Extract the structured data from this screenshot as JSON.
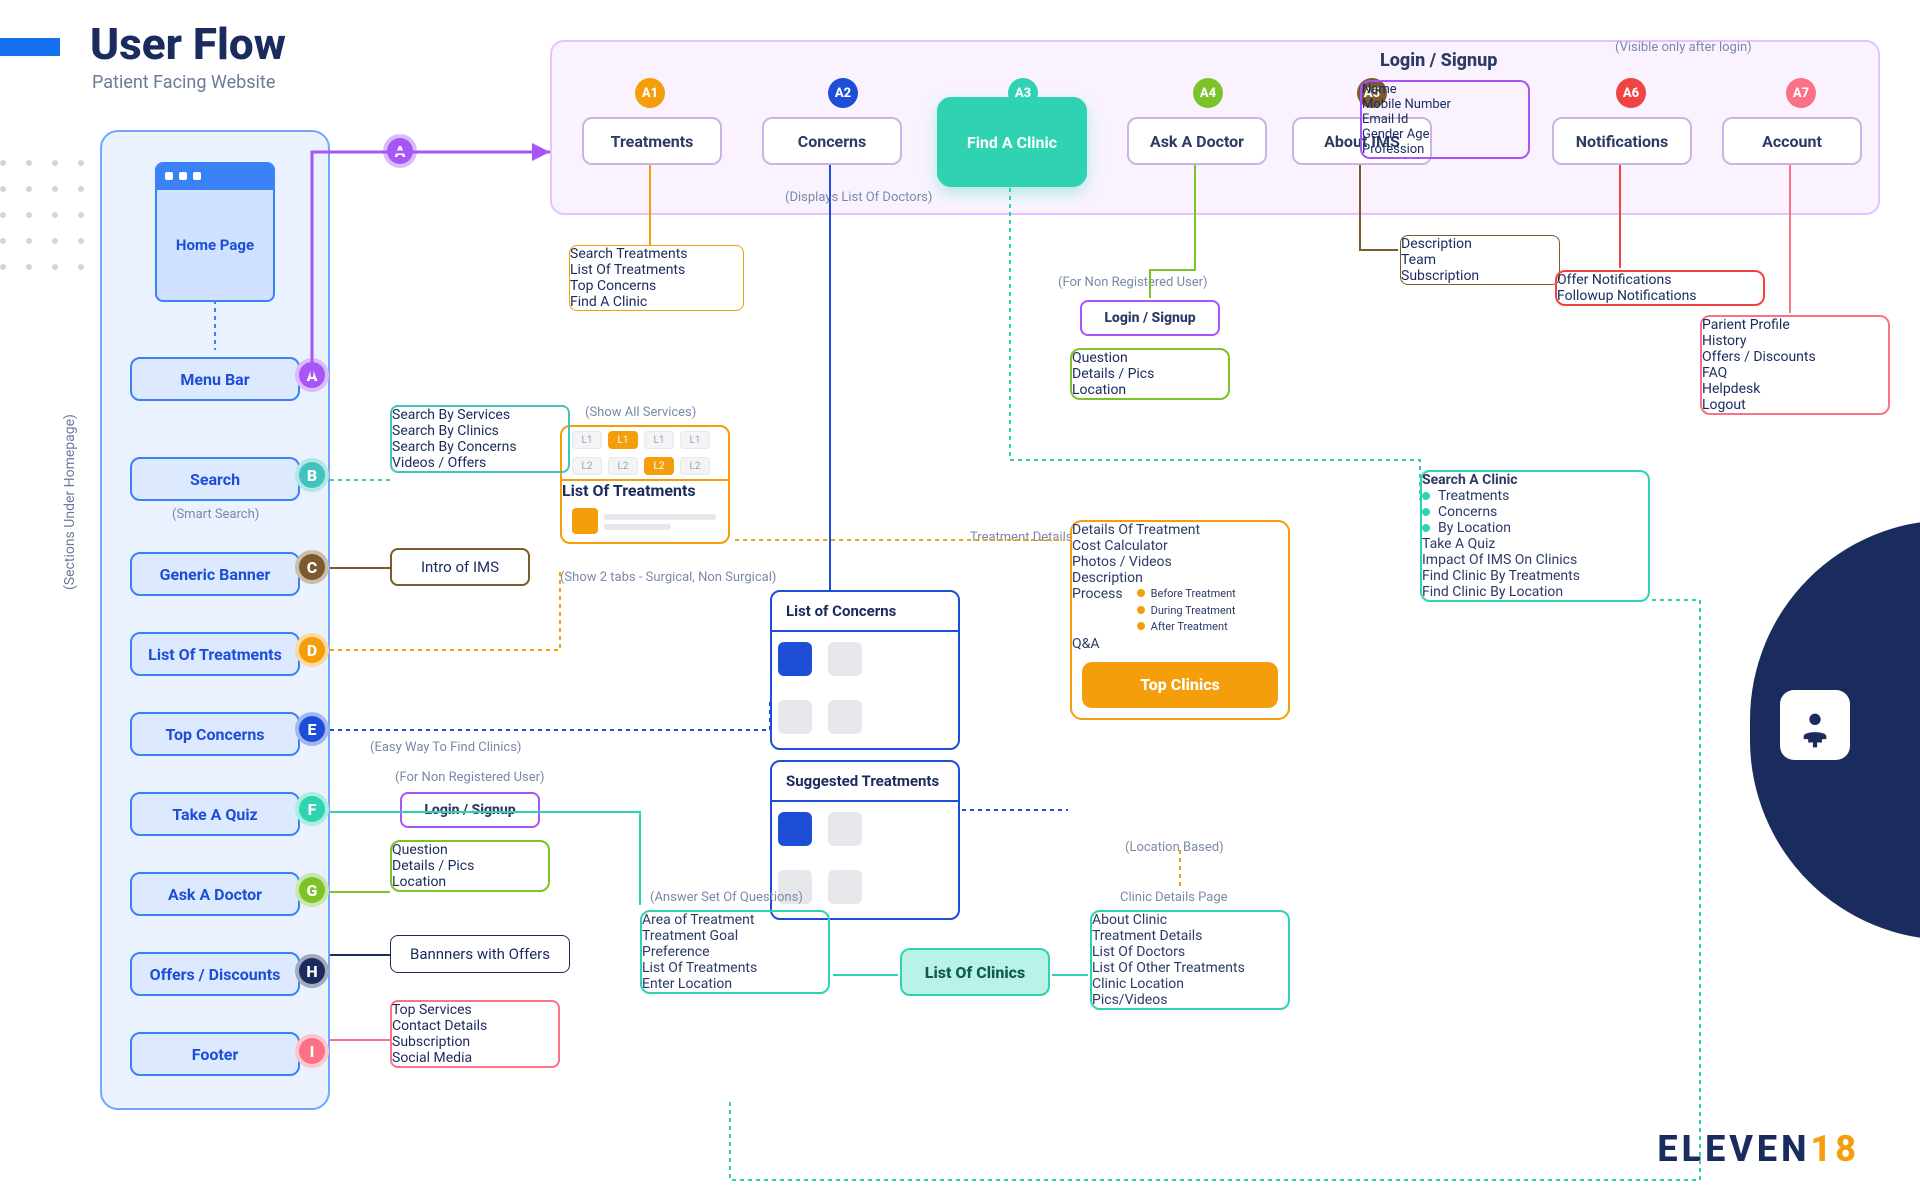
{
  "title": "User Flow",
  "subtitle": "Patient Facing Website",
  "sections_label": "(Sections Under Homepage)",
  "home": {
    "card": "Home Page",
    "items": [
      "Menu Bar",
      "Search",
      "Generic Banner",
      "List Of Treatments",
      "Top Concerns",
      "Take A Quiz",
      "Ask A Doctor",
      "Offers / Discounts",
      "Footer"
    ],
    "smart_search_note": "(Smart Search)"
  },
  "letters": [
    "A",
    "B",
    "C",
    "D",
    "E",
    "F",
    "G",
    "H",
    "I"
  ],
  "letter_colors": [
    "#a855f7",
    "#42c3bf",
    "#7c5a2d",
    "#f59e0b",
    "#1d4ed8",
    "#2fd3b2",
    "#7cc329",
    "#1a2b5e",
    "#fb7185"
  ],
  "top_container_note_right": "(Visible only after login)",
  "nav": {
    "items": [
      "Treatments",
      "Concerns",
      "Find A Clinic",
      "Ask A Doctor",
      "About IMS",
      "Notifications",
      "Account"
    ],
    "ids": [
      "A1",
      "A2",
      "A3",
      "A4",
      "A5",
      "A6",
      "A7"
    ],
    "id_colors": [
      "#f59e0b",
      "#1d4ed8",
      "#2fd3b2",
      "#7cc329",
      "#7c5a2d",
      "#ef4444",
      "#fb7185"
    ],
    "concerns_note": "(Displays List Of Doctors)"
  },
  "login_title": "Login / Signup",
  "login_fields": [
    "Name",
    "Mobile Number",
    "Email Id",
    "Gender Age",
    "Profession"
  ],
  "about_items": [
    "Description",
    "Team",
    "Subscription"
  ],
  "notif_items": [
    "Offer Notifications",
    "Followup Notifications"
  ],
  "account_items": [
    "Parient Profile",
    "History",
    "Offers / Discounts",
    "FAQ",
    "Helpdesk",
    "Logout"
  ],
  "treat_list": [
    "Search Treatments",
    "List Of Treatments",
    "Top Concerns",
    "Find A Clinic"
  ],
  "treat_panel": {
    "show_all": "(Show All Services)",
    "l1": [
      "L1",
      "L1",
      "L1",
      "L1"
    ],
    "l2": [
      "L2",
      "L2",
      "L2",
      "L2"
    ],
    "list_title": "List Of Treatments",
    "tabs_note": "(Show 2 tabs - Surgical, Non Surgical)"
  },
  "searchby": [
    "Search By Services",
    "Search By Clinics",
    "Search By Concerns",
    "Videos / Offers"
  ],
  "intro": "Intro of IMS",
  "offers_banner": "Bannners with Offers",
  "footer_items": [
    "Top Services",
    "Contact Details",
    "Subscription",
    "Social Media"
  ],
  "concerns": {
    "list_title": "List of Concerns",
    "sugg_title": "Suggested Treatments"
  },
  "tdetail": {
    "note": "Treatment Details Page",
    "items": [
      "Details Of Treatment",
      "Cost Calculator",
      "Photos / Videos",
      "Description"
    ],
    "process_label": "Process",
    "process_items": [
      "Before Treatment",
      "During Treatment",
      "After Treatment"
    ],
    "qa": "Q&A",
    "top_clinics": "Top Clinics",
    "loc_note": "(Location Based)"
  },
  "csearch": {
    "title": "Search A Clinic",
    "filters": [
      "Treatments",
      "Concerns",
      "By Location"
    ],
    "items": [
      "Take A Quiz",
      "Impact Of IMS On Clinics",
      "Find Clinic By Treatments",
      "Find Clinic By Location"
    ]
  },
  "clinic_detail": {
    "note": "Clinic Details Page",
    "items": [
      "About Clinic",
      "Treatment Details",
      "List Of Doctors",
      "List Of Other Treatments",
      "Clinic Location",
      "Pics/Videos"
    ]
  },
  "answer_set": {
    "note": "(Answer Set Of Questions)",
    "items": [
      "Area of Treatment",
      "Treatment Goal",
      "Preference",
      "List Of Treatments",
      "Enter Location"
    ]
  },
  "list_clinics": "List Of Clinics",
  "askdoc": {
    "note_left": "(Easy Way To Find Clinics)",
    "nonreg_note": "(For Non Registered User)",
    "login": "Login / Signup",
    "items": [
      "Question",
      "Details / Pics",
      "Location"
    ]
  },
  "logo": {
    "a": "ELEVEN",
    "b": "18"
  }
}
